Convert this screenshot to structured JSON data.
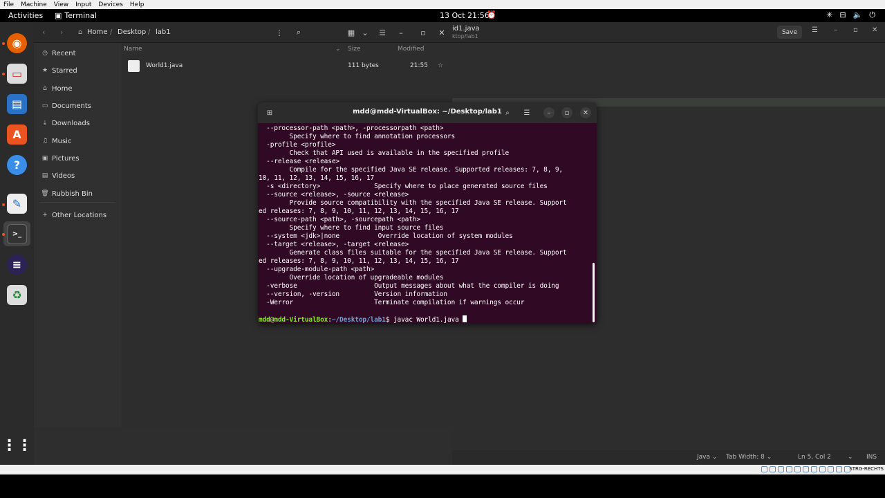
{
  "vbox_menu": [
    "File",
    "Machine",
    "View",
    "Input",
    "Devices",
    "Help"
  ],
  "topbar": {
    "activities": "Activities",
    "app_name": "Terminal",
    "clock": "13 Oct  21:56"
  },
  "files": {
    "breadcrumb": [
      "Home",
      "Desktop",
      "lab1"
    ],
    "sidebar": [
      {
        "label": "Recent",
        "icon": "clock-icon"
      },
      {
        "label": "Starred",
        "icon": "star-icon"
      },
      {
        "label": "Home",
        "icon": "home-icon"
      },
      {
        "label": "Documents",
        "icon": "document-icon"
      },
      {
        "label": "Downloads",
        "icon": "download-icon"
      },
      {
        "label": "Music",
        "icon": "music-icon"
      },
      {
        "label": "Pictures",
        "icon": "picture-icon"
      },
      {
        "label": "Videos",
        "icon": "video-icon"
      },
      {
        "label": "Rubbish Bin",
        "icon": "trash-icon"
      }
    ],
    "other_locations": "Other Locations",
    "columns": {
      "name": "Name",
      "size": "Size",
      "modified": "Modified"
    },
    "rows": [
      {
        "name": "World1.java",
        "size": "111 bytes",
        "modified": "21:55"
      }
    ]
  },
  "editor": {
    "title": "id1.java",
    "subtitle": "ktop/lab1",
    "save_label": "Save",
    "status": {
      "language": "Java",
      "tab_width": "Tab Width: 8",
      "position": "Ln 5, Col 2",
      "mode": "INS"
    }
  },
  "terminal": {
    "title": "mdd@mdd-VirtualBox: ~/Desktop/lab1",
    "lines": [
      "  --processor-path <path>, -processorpath <path>",
      "        Specify where to find annotation processors",
      "  -profile <profile>",
      "        Check that API used is available in the specified profile",
      "  --release <release>",
      "        Compile for the specified Java SE release. Supported releases: 7, 8, 9,",
      "10, 11, 12, 13, 14, 15, 16, 17",
      "  -s <directory>              Specify where to place generated source files",
      "  --source <release>, -source <release>",
      "        Provide source compatibility with the specified Java SE release. Support",
      "ed releases: 7, 8, 9, 10, 11, 12, 13, 14, 15, 16, 17",
      "  --source-path <path>, -sourcepath <path>",
      "        Specify where to find input source files",
      "  --system <jdk>|none          Override location of system modules",
      "  --target <release>, -target <release>",
      "        Generate class files suitable for the specified Java SE release. Support",
      "ed releases: 7, 8, 9, 10, 11, 12, 13, 14, 15, 16, 17",
      "  --upgrade-module-path <path>",
      "        Override location of upgradeable modules",
      "  -verbose                    Output messages about what the compiler is doing",
      "  --version, -version         Version information",
      "  -Werror                     Terminate compilation if warnings occur"
    ],
    "prompt_user": "mdd@mdd-VirtualBox",
    "prompt_path": "~/Desktop/lab1",
    "prompt_symbol": "$ ",
    "command": "javac World1.java "
  },
  "vbox_status": {
    "host_key": "STRG-RECHTS"
  },
  "colors": {
    "terminal_bg": "#300a24",
    "accent": "#e95420",
    "prompt_user": "#8ae234",
    "prompt_path": "#729fcf"
  }
}
